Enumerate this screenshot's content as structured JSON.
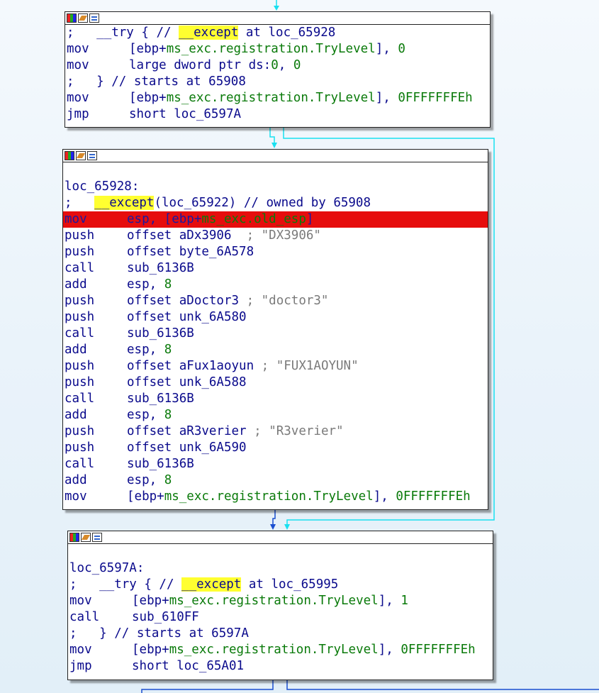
{
  "blocks": [
    {
      "lines": [
        {
          "parts": [
            [
              ";",
              ""
            ],
            [
              "   __try { // ",
              ""
            ],
            [
              "__except",
              "kw"
            ],
            [
              " at loc_65928",
              ""
            ]
          ]
        },
        {
          "mn": "mov",
          "parts": [
            [
              "[ebp+",
              ""
            ],
            [
              "ms_exc.registration.TryLevel",
              "grn"
            ],
            [
              "], ",
              ""
            ],
            [
              "0",
              "num"
            ]
          ]
        },
        {
          "mn": "mov",
          "parts": [
            [
              "large dword ptr ds:",
              ""
            ],
            [
              "0",
              "num"
            ],
            [
              ", ",
              ""
            ],
            [
              "0",
              "num"
            ]
          ]
        },
        {
          "parts": [
            [
              ";   } // starts at 65908",
              ""
            ]
          ]
        },
        {
          "mn": "mov",
          "parts": [
            [
              "[ebp+",
              ""
            ],
            [
              "ms_exc.registration.TryLevel",
              "grn"
            ],
            [
              "], ",
              ""
            ],
            [
              "0FFFFFFFEh",
              "num"
            ]
          ]
        },
        {
          "mn": "jmp",
          "parts": [
            [
              "short loc_6597A",
              ""
            ]
          ]
        }
      ]
    },
    {
      "lines": [
        {
          "blank": true
        },
        {
          "parts": [
            [
              "loc_65928:",
              ""
            ]
          ]
        },
        {
          "parts": [
            [
              ";   ",
              ""
            ],
            [
              "__except",
              "kw"
            ],
            [
              "(loc_65922) // owned by 65908",
              ""
            ]
          ]
        },
        {
          "mn": "mov",
          "hl": true,
          "parts": [
            [
              "esp, [ebp+",
              ""
            ],
            [
              "ms_exc.old_esp",
              "grn"
            ],
            [
              "]",
              ""
            ]
          ]
        },
        {
          "mn": "push",
          "parts": [
            [
              "offset aDx3906  ",
              ""
            ],
            [
              "; \"DX3906\"",
              "cmt"
            ]
          ]
        },
        {
          "mn": "push",
          "parts": [
            [
              "offset byte_6A578",
              ""
            ]
          ]
        },
        {
          "mn": "call",
          "parts": [
            [
              "sub_6136B",
              ""
            ]
          ]
        },
        {
          "mn": "add",
          "parts": [
            [
              "esp, ",
              ""
            ],
            [
              "8",
              "num"
            ]
          ]
        },
        {
          "mn": "push",
          "parts": [
            [
              "offset aDoctor3 ",
              ""
            ],
            [
              "; \"doctor3\"",
              "cmt"
            ]
          ]
        },
        {
          "mn": "push",
          "parts": [
            [
              "offset unk_6A580",
              ""
            ]
          ]
        },
        {
          "mn": "call",
          "parts": [
            [
              "sub_6136B",
              ""
            ]
          ]
        },
        {
          "mn": "add",
          "parts": [
            [
              "esp, ",
              ""
            ],
            [
              "8",
              "num"
            ]
          ]
        },
        {
          "mn": "push",
          "parts": [
            [
              "offset aFux1aoyun ",
              ""
            ],
            [
              "; \"FUX1AOYUN\"",
              "cmt"
            ]
          ]
        },
        {
          "mn": "push",
          "parts": [
            [
              "offset unk_6A588",
              ""
            ]
          ]
        },
        {
          "mn": "call",
          "parts": [
            [
              "sub_6136B",
              ""
            ]
          ]
        },
        {
          "mn": "add",
          "parts": [
            [
              "esp, ",
              ""
            ],
            [
              "8",
              "num"
            ]
          ]
        },
        {
          "mn": "push",
          "parts": [
            [
              "offset aR3verier ",
              ""
            ],
            [
              "; \"R3verier\"",
              "cmt"
            ]
          ]
        },
        {
          "mn": "push",
          "parts": [
            [
              "offset unk_6A590",
              ""
            ]
          ]
        },
        {
          "mn": "call",
          "parts": [
            [
              "sub_6136B",
              ""
            ]
          ]
        },
        {
          "mn": "add",
          "parts": [
            [
              "esp, ",
              ""
            ],
            [
              "8",
              "num"
            ]
          ]
        },
        {
          "mn": "mov",
          "parts": [
            [
              "[ebp+",
              ""
            ],
            [
              "ms_exc.registration.TryLevel",
              "grn"
            ],
            [
              "], ",
              ""
            ],
            [
              "0FFFFFFFEh",
              "num"
            ]
          ]
        }
      ]
    },
    {
      "lines": [
        {
          "blank": true
        },
        {
          "parts": [
            [
              "loc_6597A:",
              ""
            ]
          ]
        },
        {
          "parts": [
            [
              ";   __try { // ",
              ""
            ],
            [
              "__except",
              "kw"
            ],
            [
              " at loc_65995",
              ""
            ]
          ]
        },
        {
          "mn": "mov",
          "parts": [
            [
              "[ebp+",
              ""
            ],
            [
              "ms_exc.registration.TryLevel",
              "grn"
            ],
            [
              "], ",
              ""
            ],
            [
              "1",
              "num"
            ]
          ]
        },
        {
          "mn": "call",
          "parts": [
            [
              "sub_610FF",
              ""
            ]
          ]
        },
        {
          "parts": [
            [
              ";   } // starts at 6597A",
              ""
            ]
          ]
        },
        {
          "mn": "mov",
          "parts": [
            [
              "[ebp+",
              ""
            ],
            [
              "ms_exc.registration.TryLevel",
              "grn"
            ],
            [
              "], ",
              ""
            ],
            [
              "0FFFFFFFEh",
              "num"
            ]
          ]
        },
        {
          "mn": "jmp",
          "parts": [
            [
              "short loc_65A01",
              ""
            ]
          ]
        }
      ]
    }
  ],
  "colors": {
    "edge_cyan": "#19e0f0",
    "edge_blue": "#1a4fd0",
    "highlight": "#e60d0d",
    "keyword_bg": "#ffff30"
  },
  "icons": [
    "palette-icon",
    "edit-icon",
    "graph-icon"
  ]
}
